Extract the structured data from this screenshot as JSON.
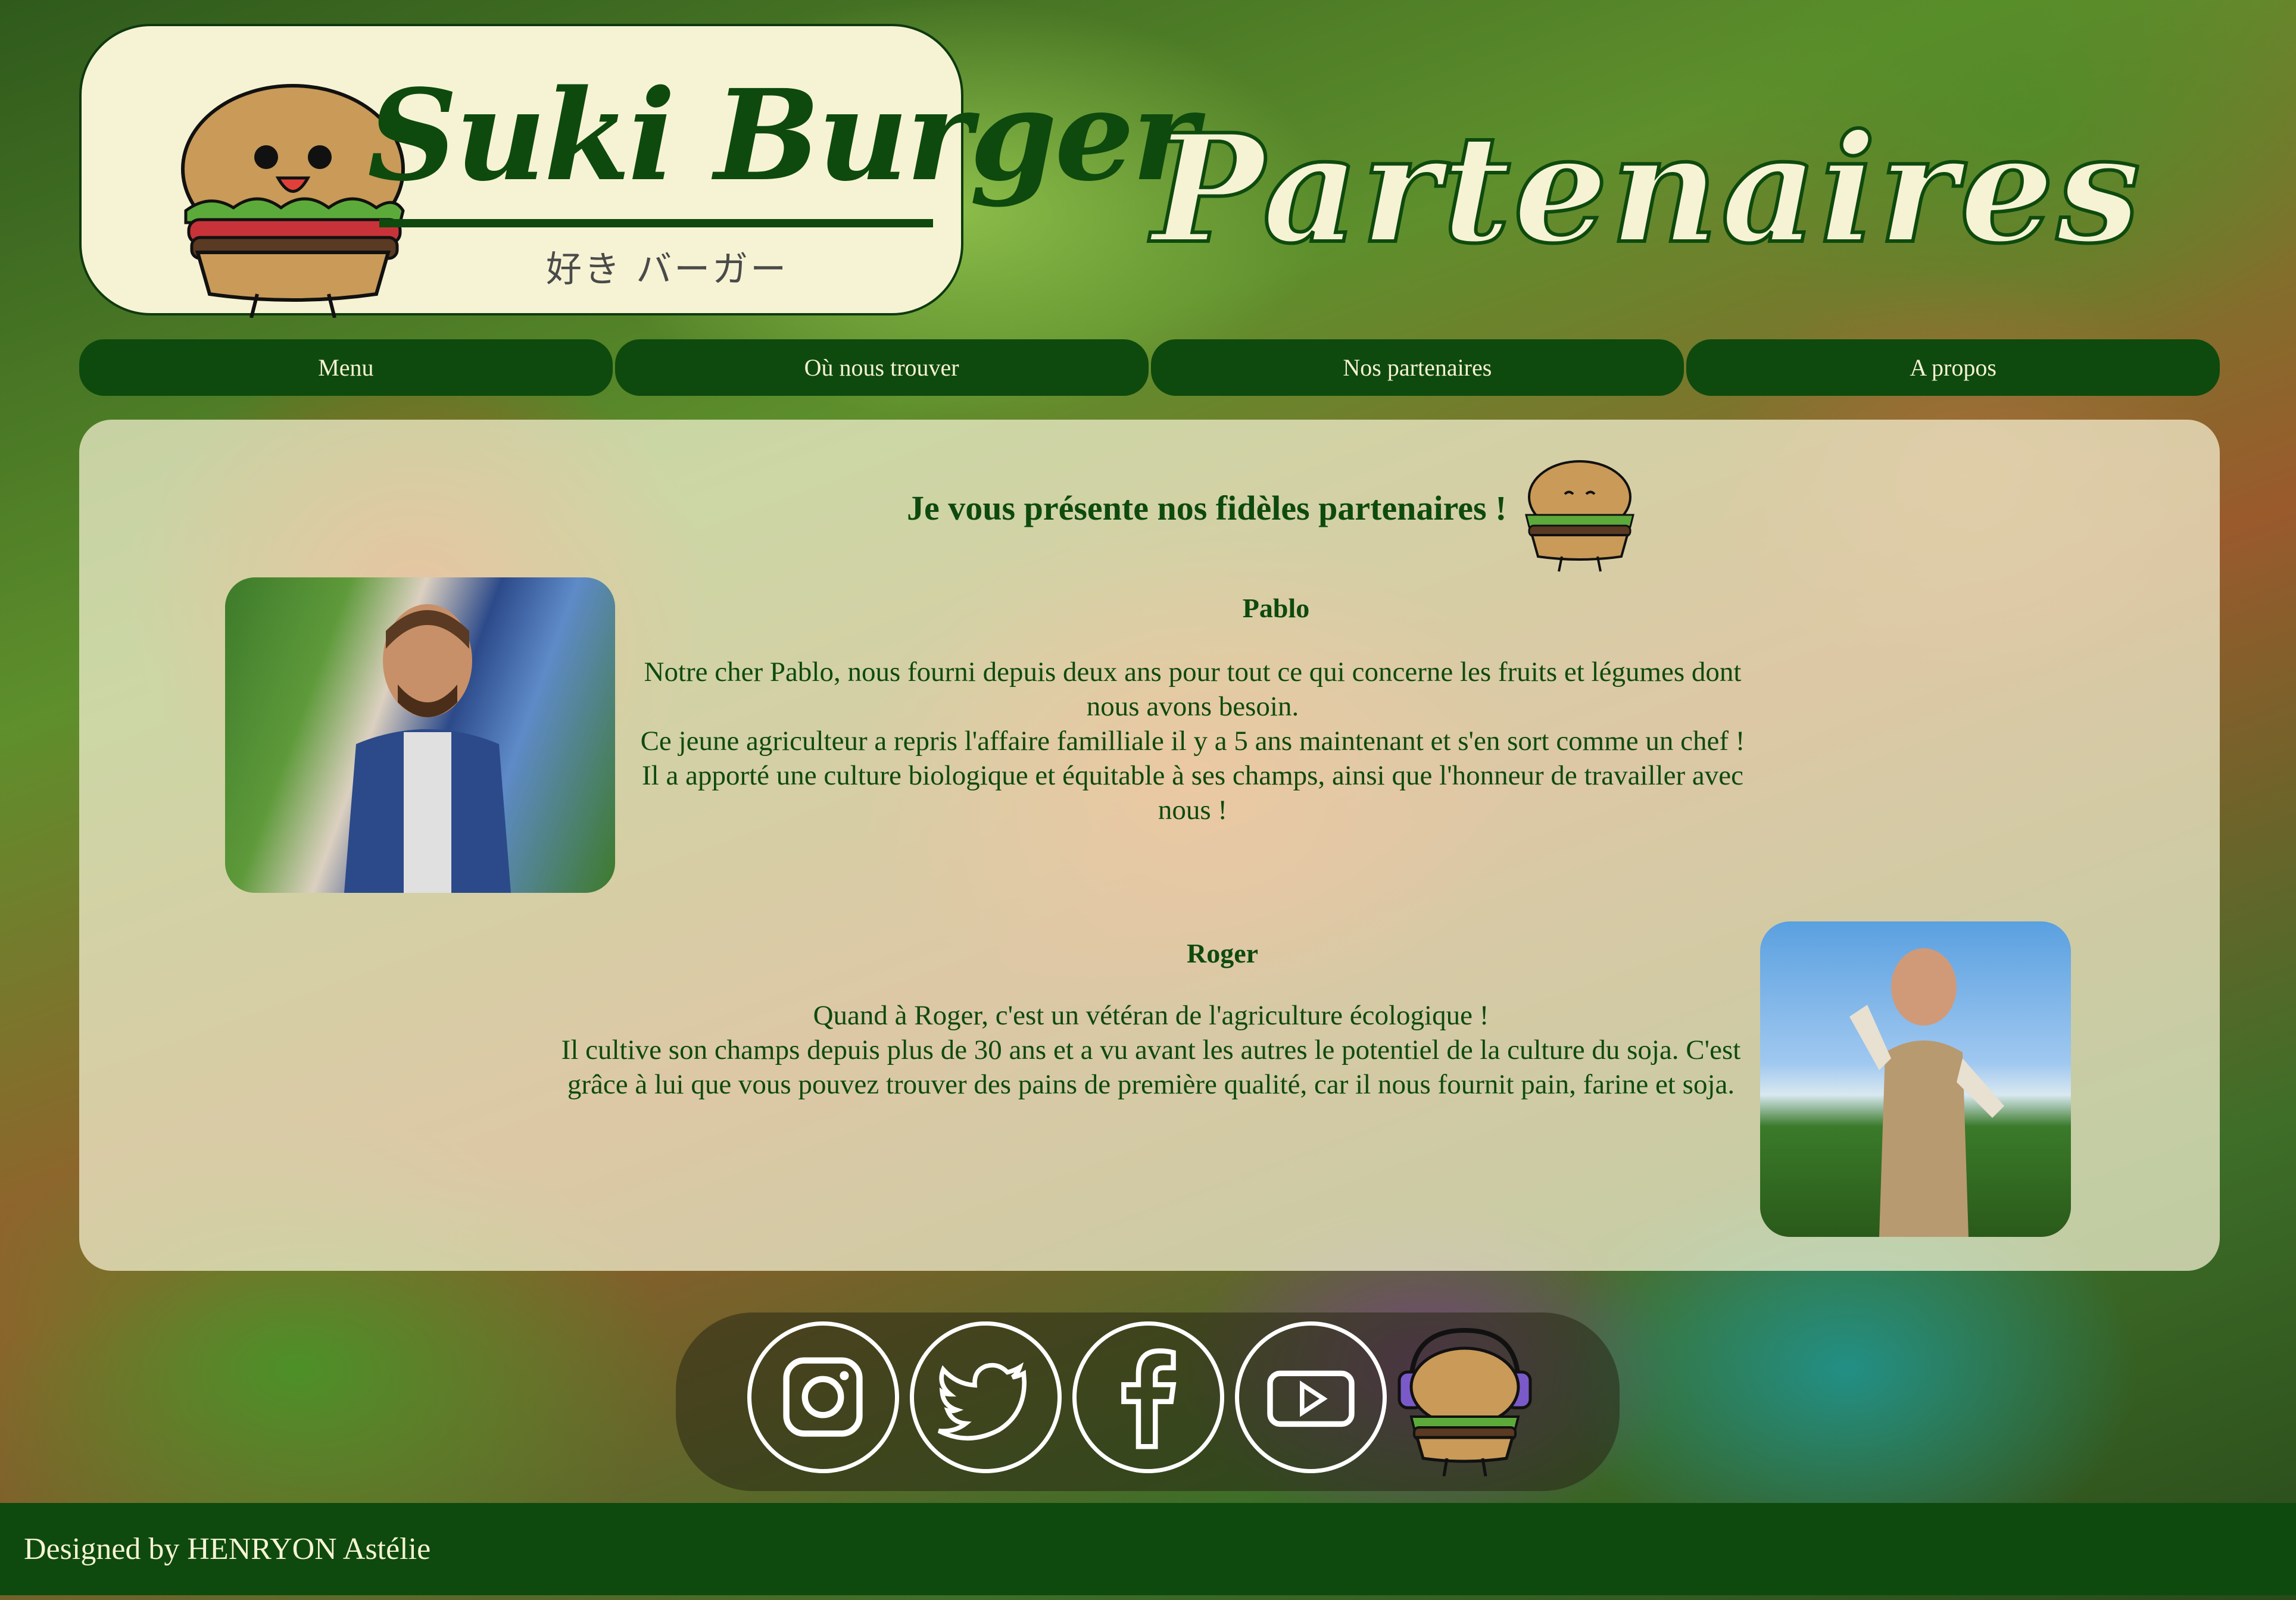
{
  "brand": {
    "name": "Suki Burger",
    "subtitle": "好き バーガー"
  },
  "page_title": "Partenaires",
  "nav": {
    "items": [
      {
        "label": "Menu"
      },
      {
        "label": "Où nous trouver"
      },
      {
        "label": "Nos partenaires"
      },
      {
        "label": "A propos"
      }
    ]
  },
  "main": {
    "heading": "Je vous présente nos fidèles partenaires !",
    "partners": [
      {
        "name": "Pablo",
        "text": "Notre cher Pablo, nous fourni depuis deux ans pour tout ce qui concerne les fruits et légumes dont nous avons besoin.\nCe jeune agriculteur a repris l'affaire familliale il y a 5 ans maintenant et s'en sort comme un chef !\nIl a apporté une culture biologique et équitable à ses champs, ainsi que l'honneur de travailler avec nous !"
      },
      {
        "name": "Roger",
        "text": "Quand à Roger, c'est un vétéran de l'agriculture écologique !\nIl cultive son champs depuis plus de 30 ans et a vu avant les autres le potentiel de la culture du soja. C'est grâce à lui que vous pouvez trouver des pains de première qualité, car il nous fournit pain, farine et soja."
      }
    ]
  },
  "social": {
    "icons": [
      "instagram-icon",
      "twitter-icon",
      "facebook-icon",
      "youtube-icon"
    ]
  },
  "footer": {
    "credit": "Designed by HENRYON Astélie"
  },
  "colors": {
    "primary_green": "#0e4a0e",
    "cream": "#f6f3d4"
  }
}
